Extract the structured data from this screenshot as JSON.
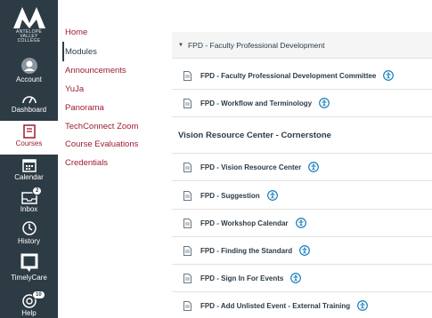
{
  "global_nav": {
    "logo_text": [
      "ANTELOPE",
      "VALLEY",
      "COLLEGE"
    ],
    "items": [
      {
        "label": "Account",
        "icon": "account-icon"
      },
      {
        "label": "Dashboard",
        "icon": "dashboard-icon"
      },
      {
        "label": "Courses",
        "icon": "courses-icon",
        "active": true
      },
      {
        "label": "Calendar",
        "icon": "calendar-icon"
      },
      {
        "label": "Inbox",
        "icon": "inbox-icon",
        "badge": "2"
      },
      {
        "label": "History",
        "icon": "history-icon"
      },
      {
        "label": "TimelyCare",
        "icon": "timelycare-icon"
      },
      {
        "label": "Help",
        "icon": "help-icon",
        "badge": "10"
      }
    ]
  },
  "course_nav": {
    "items": [
      "Home",
      "Modules",
      "Announcements",
      "YuJa",
      "Panorama",
      "TechConnect Zoom",
      "Course Evaluations",
      "Credentials"
    ],
    "active": "Modules"
  },
  "modules": {
    "module_title": "FPD - Faculty Professional Development",
    "items_top": [
      "FPD - Faculty Professional Development Committee",
      "FPD - Workflow and Terminology"
    ],
    "subheader": "Vision Resource Center - Cornerstone",
    "items_bottom": [
      "FPD - Vision Resource Center",
      "FPD - Suggestion",
      "FPD - Workshop Calendar",
      "FPD - Finding the Standard",
      "FPD - Sign In For Events",
      "FPD - Add Unlisted Event - External Training"
    ]
  },
  "colors": {
    "nav_bg": "#2d3b45",
    "link": "#9e1b32",
    "info": "#0374b5"
  }
}
